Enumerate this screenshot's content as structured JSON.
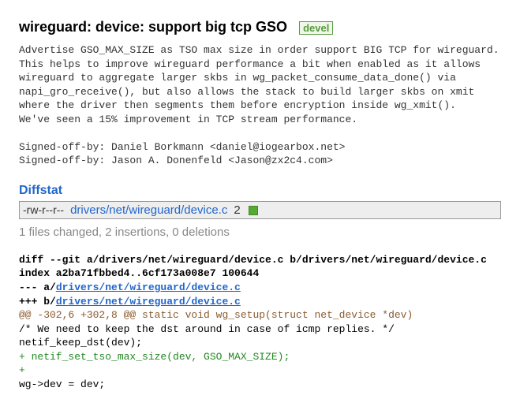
{
  "header": {
    "title": "wireguard: device: support big tcp GSO",
    "tag": "devel"
  },
  "commit_msg": "Advertise GSO_MAX_SIZE as TSO max size in order support BIG TCP for wireguard.\nThis helps to improve wireguard performance a bit when enabled as it allows\nwireguard to aggregate larger skbs in wg_packet_consume_data_done() via\nnapi_gro_receive(), but also allows the stack to build larger skbs on xmit\nwhere the driver then segments them before encryption inside wg_xmit().\nWe've seen a 15% improvement in TCP stream performance.\n\nSigned-off-by: Daniel Borkmann <daniel@iogearbox.net>\nSigned-off-by: Jason A. Donenfeld <Jason@zx2c4.com>",
  "diffstat": {
    "heading": "Diffstat",
    "rows": [
      {
        "mode": "-rw-r--r--",
        "file": "drivers/net/wireguard/device.c",
        "changes": "2"
      }
    ]
  },
  "summary": "1 files changed, 2 insertions, 0 deletions",
  "diff": {
    "l1": "diff --git a/drivers/net/wireguard/device.c b/drivers/net/wireguard/device.c",
    "l2": "index a2ba71fbbed4..6cf173a008e7 100644",
    "l3": "--- a/",
    "l3a": "drivers/net/wireguard/device.c",
    "l4": "+++ b/",
    "l4a": "drivers/net/wireguard/device.c",
    "l5": "@@ -302,6 +302,8 @@ static void wg_setup(struct net_device *dev)",
    "l6": "        /* We need to keep the dst around in case of icmp replies. */",
    "l7": "        netif_keep_dst(dev);",
    "l8": "",
    "l9": "+       netif_set_tso_max_size(dev, GSO_MAX_SIZE);",
    "l10": "+",
    "l11": "        wg->dev = dev;"
  }
}
